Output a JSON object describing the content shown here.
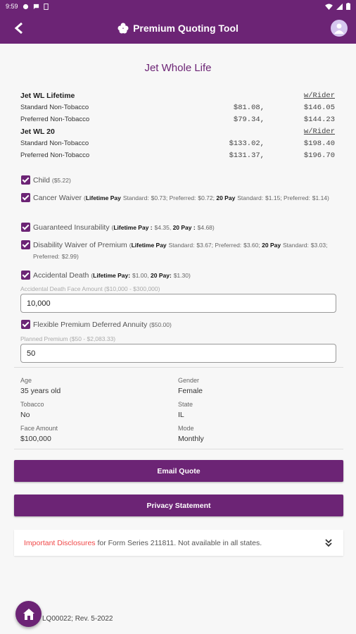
{
  "status": {
    "time": "9:59"
  },
  "appbar": {
    "title": "Premium Quoting Tool"
  },
  "product_title": "Jet Whole Life",
  "rates": [
    {
      "name": "Jet WL Lifetime",
      "rider_header": "w/Rider",
      "rows": [
        {
          "label": "Standard Non-Tobacco",
          "base": "$81.08,",
          "rider": "$146.05"
        },
        {
          "label": "Preferred Non-Tobacco",
          "base": "$79.34,",
          "rider": "$144.23"
        }
      ]
    },
    {
      "name": "Jet WL 20",
      "rider_header": "w/Rider",
      "rows": [
        {
          "label": "Standard Non-Tobacco",
          "base": "$133.02,",
          "rider": "$198.40"
        },
        {
          "label": "Preferred Non-Tobacco",
          "base": "$131.37,",
          "rider": "$196.70"
        }
      ]
    }
  ],
  "options": {
    "child": {
      "label": "Child",
      "price": "($5.22)"
    },
    "cancer": {
      "label": "Cancer Waiver",
      "lp": "Lifetime Pay",
      "std": "Standard:",
      "v1": "$0.73",
      "pref": "; Preferred:",
      "v2": "$0.72",
      "p20": "20 Pay",
      "std2": "Standard:",
      "v3": "$1.15",
      "pref2": "; Preferred:",
      "v4": "$1.14"
    },
    "guaranteed": {
      "label": "Guaranteed Insurability",
      "lp": "Lifetime Pay :",
      "v1": "$4.35",
      "p20": "20 Pay :",
      "v2": "$4.68"
    },
    "disability": {
      "label": "Disability Waiver of Premium",
      "lp": "Lifetime Pay",
      "std": "Standard:",
      "v1": "$3.67",
      "pref": "; Preferred:",
      "v2": "$3.60",
      "p20": "20 Pay",
      "std2": "Standard:",
      "v3": "$3.03",
      "pref2": "; Preferred:",
      "v4": "$2.99"
    },
    "accidental": {
      "label": "Accidental Death",
      "lp": "Lifetime Pay:",
      "v1": "$1.00",
      "p20": "20 Pay:",
      "v2": "$1.30"
    },
    "accidental_hint": "Accidental Death Face Amount ($10,000 - $300,000)",
    "accidental_value": "10,000",
    "flexible": {
      "label": "Flexible Premium Deferred Annuity",
      "price": "($50.00)"
    },
    "flexible_hint": "Planned Premium ($50 - $2,083.33)",
    "flexible_value": "50"
  },
  "info": {
    "age_k": "Age",
    "age_v": "35 years old",
    "gender_k": "Gender",
    "gender_v": "Female",
    "tobacco_k": "Tobacco",
    "tobacco_v": "No",
    "state_k": "State",
    "state_v": "IL",
    "face_k": "Face Amount",
    "face_v": "$100,000",
    "mode_k": "Mode",
    "mode_v": "Monthly"
  },
  "buttons": {
    "email": "Email Quote",
    "privacy": "Privacy Statement"
  },
  "disclosure": {
    "link": "Important Disclosures",
    "text": "for Form Series 211811. Not available in all states."
  },
  "footer": "LQ00022; Rev. 5-2022",
  "colors": {
    "brand": "#6c2475",
    "price_green": "#7cc27c",
    "disclosure_red": "#f04747"
  }
}
